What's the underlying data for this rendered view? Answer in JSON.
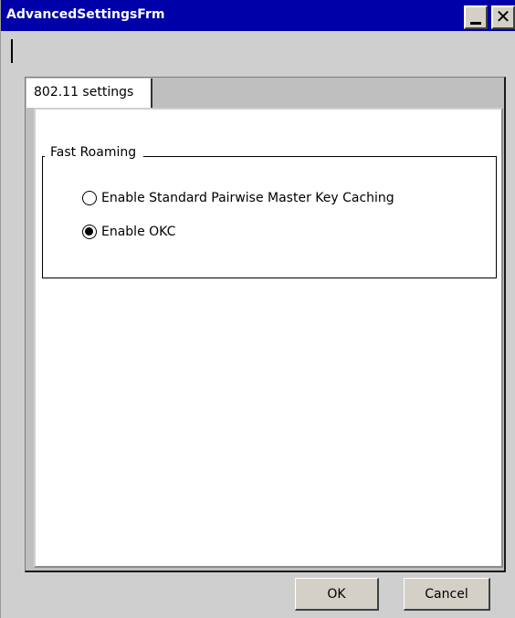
{
  "window": {
    "title": "AdvancedSettingsFrm",
    "minimize_icon": "minimize-icon",
    "close_icon": "close-icon",
    "close_glyph": "✕"
  },
  "tabs": [
    {
      "label": "802.11 settings",
      "selected": true
    }
  ],
  "fast_roaming": {
    "title": "Fast Roaming",
    "options": [
      {
        "label": "Enable Standard Pairwise Master Key Caching",
        "checked": false
      },
      {
        "label": "Enable OKC",
        "checked": true
      }
    ]
  },
  "buttons": {
    "ok_label": "OK",
    "cancel_label": "Cancel"
  },
  "colors": {
    "titlebar": "#0000a8",
    "window_bg": "#cfcfcf",
    "page_bg": "#ffffff"
  }
}
